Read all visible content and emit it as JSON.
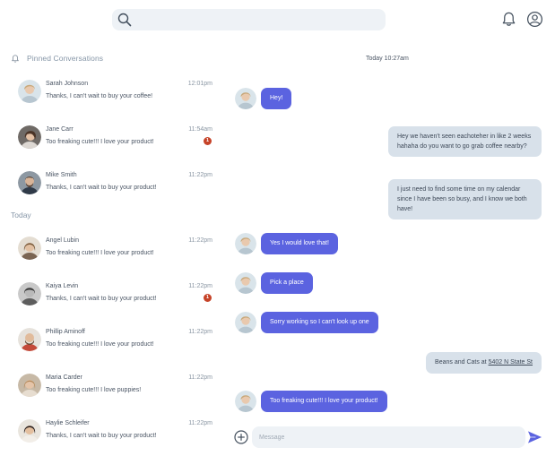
{
  "search": {
    "placeholder": ""
  },
  "pinned": {
    "label": "Pinned Conversations",
    "items": [
      {
        "name": "Sarah Johnson",
        "preview": "Thanks, I can't wait to buy your coffee!",
        "time": "12:01pm",
        "unread": ""
      },
      {
        "name": "Jane Carr",
        "preview": "Too freaking cute!!! I love your product!",
        "time": "11:54am",
        "unread": "1"
      },
      {
        "name": "Mike Smith",
        "preview": "Thanks, I can't wait to buy your product!",
        "time": "11:22pm",
        "unread": ""
      }
    ]
  },
  "today": {
    "label": "Today",
    "items": [
      {
        "name": "Angel Lubin",
        "preview": "Too freaking cute!!! I love your product!",
        "time": "11:22pm",
        "unread": ""
      },
      {
        "name": "Kaiya Levin",
        "preview": "Thanks, I can't wait to buy your product!",
        "time": "11:22pm",
        "unread": "1"
      },
      {
        "name": "Phillip Aminoff",
        "preview": "Too freaking cute!!! I love your product!",
        "time": "11:22pm",
        "unread": ""
      },
      {
        "name": "Maria Carder",
        "preview": "Too freaking cute!!! I love puppies!",
        "time": "11:22pm",
        "unread": ""
      },
      {
        "name": "Haylie Schleifer",
        "preview": "Thanks, I can't wait to buy your product!",
        "time": "11:22pm",
        "unread": ""
      }
    ]
  },
  "chat": {
    "date": "Today 10:27am",
    "messages": [
      {
        "dir": "in",
        "text": "Hey!"
      },
      {
        "dir": "out",
        "text": "Hey we haven't seen eachoteher in like 2 weeks hahaha do you want to go grab coffee nearby?"
      },
      {
        "dir": "out",
        "text": "I just need to find some time on my calendar since I have been so busy, and I know we both have!"
      },
      {
        "dir": "in",
        "text": "Yes I would love that!"
      },
      {
        "dir": "in",
        "text": "Pick a place"
      },
      {
        "dir": "in",
        "text": "Sorry working so I can't look up one"
      },
      {
        "dir": "out",
        "text_prefix": "Beans and Cats at ",
        "link": "5402 N State St"
      },
      {
        "dir": "in",
        "text": "Too freaking cute!!! I love your product!"
      }
    ]
  },
  "composer": {
    "placeholder": "Message"
  },
  "icons": {
    "search": "search-icon",
    "notifications": "bell-icon",
    "profile": "user-icon",
    "pinned": "bell-icon",
    "add": "plus-circle-icon",
    "send": "send-icon"
  },
  "colors": {
    "accent": "#5b63e0",
    "outgoing_bubble": "#d8e1ea",
    "badge": "#c64328",
    "input_bg": "#eef2f6"
  }
}
